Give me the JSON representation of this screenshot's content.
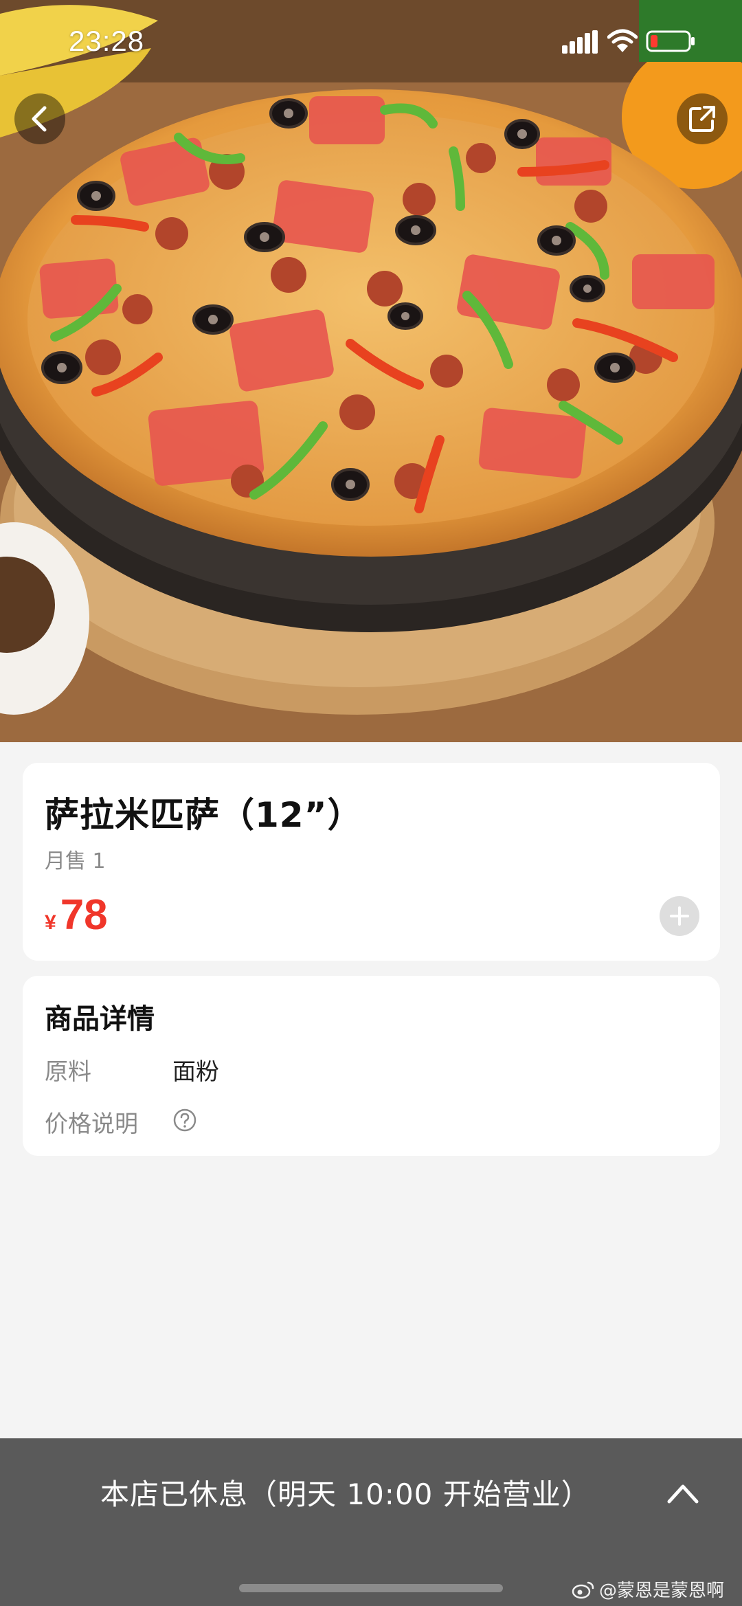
{
  "status_bar": {
    "time": "23:28"
  },
  "product": {
    "name": "萨拉米匹萨（12”）",
    "monthly_sales": "月售 1",
    "price_symbol": "¥",
    "price": "78"
  },
  "details": {
    "title": "商品详情",
    "rows": [
      {
        "label": "原料",
        "value": "面粉"
      },
      {
        "label": "价格说明",
        "value": ""
      }
    ]
  },
  "bottom_bar": {
    "closed_text": "本店已休息（明天 10:00 开始营业）"
  },
  "watermark": "@蒙恩是蒙恩啊",
  "icons": {
    "back": "back-arrow-icon",
    "share": "share-icon",
    "add": "plus-icon",
    "help": "question-mark-icon",
    "expand": "chevron-up-icon"
  },
  "colors": {
    "price": "#f0362a",
    "bottom_bar": "#5a5a5a",
    "page_bg": "#f4f4f4"
  }
}
